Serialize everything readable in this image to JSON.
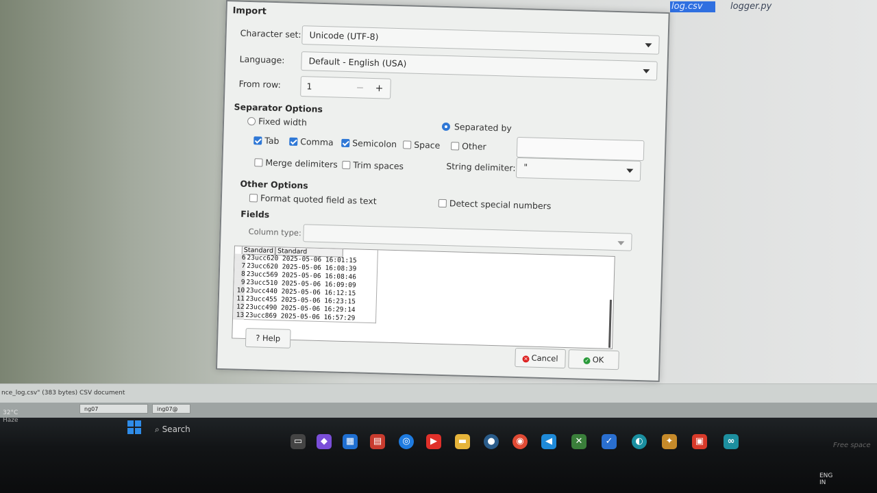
{
  "desktop": {
    "files": [
      "log.csv",
      "logger.py"
    ],
    "status_text": "nce_log.csv\" (383 bytes) CSV document",
    "taskbar_buttons": [
      "ng07",
      "ing07@"
    ],
    "weather": {
      "temp": "32°C",
      "condition": "Haze"
    },
    "search_label": "Search",
    "tray": {
      "lang": "ENG",
      "region": "IN"
    },
    "free_space": "Free space"
  },
  "dialog": {
    "title": "Import",
    "charset_label": "Character set:",
    "charset_value": "Unicode (UTF-8)",
    "language_label": "Language:",
    "language_value": "Default - English (USA)",
    "from_row_label": "From row:",
    "from_row_value": "1",
    "minus": "−",
    "plus": "+",
    "separator_options": "Separator Options",
    "fixed_width": "Fixed width",
    "separated_by": "Separated by",
    "tab": "Tab",
    "comma": "Comma",
    "semicolon": "Semicolon",
    "space": "Space",
    "other": "Other",
    "merge_delimiters": "Merge delimiters",
    "trim_spaces": "Trim spaces",
    "string_delimiter_label": "String delimiter:",
    "string_delimiter_value": "\"",
    "other_options": "Other Options",
    "format_quoted": "Format quoted field as text",
    "detect_special": "Detect special numbers",
    "fields": "Fields",
    "column_type_label": "Column type:",
    "column_type_value": "",
    "preview_headers": [
      "Standard",
      "Standard"
    ],
    "preview_rows": [
      {
        "n": "6",
        "a": "23ucc620",
        "b": "2025-05-06 16:01:15"
      },
      {
        "n": "7",
        "a": "23ucc620",
        "b": "2025-05-06 16:08:39"
      },
      {
        "n": "8",
        "a": "23ucc569",
        "b": "2025-05-06 16:08:46"
      },
      {
        "n": "9",
        "a": "23ucc510",
        "b": "2025-05-06 16:09:09"
      },
      {
        "n": "10",
        "a": "23ucc440",
        "b": "2025-05-06 16:12:15"
      },
      {
        "n": "11",
        "a": "23ucc455",
        "b": "2025-05-06 16:23:15"
      },
      {
        "n": "12",
        "a": "23ucc490",
        "b": "2025-05-06 16:29:14"
      },
      {
        "n": "13",
        "a": "23ucc869",
        "b": "2025-05-06 16:57:29"
      }
    ],
    "help": "? Help",
    "cancel": "Cancel",
    "ok": "OK"
  }
}
